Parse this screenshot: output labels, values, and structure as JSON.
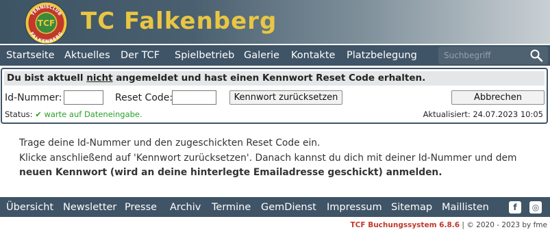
{
  "header": {
    "site_title": "TC Falkenberg",
    "logo_text_top": "TENNISCLUB",
    "logo_text_center": "TCF",
    "logo_text_bottom": "FALKENBERG"
  },
  "topnav": {
    "items": [
      "Startseite",
      "Aktuelles",
      "Der TCF",
      "Spielbetrieb",
      "Galerie",
      "Kontakte",
      "Platzbelegung"
    ]
  },
  "search": {
    "placeholder": "Suchbegriff",
    "value": ""
  },
  "reset_panel": {
    "heading_prefix": "Du bist aktuell ",
    "heading_emph": "nicht",
    "heading_suffix": " angemeldet und hast einen Kennwort Reset Code erhalten.",
    "id_label": "Id-Nummer:",
    "id_value": "",
    "code_label": "Reset Code:",
    "code_value": "",
    "reset_button": "Kennwort zurücksetzen",
    "cancel_button": "Abbrechen",
    "status_label": "Status:",
    "status_check": "✔",
    "status_text": "warte auf Dateneingabe.",
    "updated_text": "Aktualisiert: 24.07.2023 10:05"
  },
  "instructions": {
    "line1": "Trage deine Id-Nummer und den zugeschickten Reset Code ein.",
    "line2": "Klicke anschließend auf 'Kennwort zurücksetzen'. Danach kannst du dich mit deiner Id-Nummer und dem",
    "line3_bold": "neuen Kennwort",
    "line3_rest": " (wird an deine hinterlegte Emailadresse geschickt) anmelden."
  },
  "footnav": {
    "items": [
      "Übersicht",
      "Newsletter",
      "Presse",
      "Archiv",
      "Termine",
      "GemDienst",
      "Impressum",
      "Sitemap",
      "Maillisten"
    ],
    "facebook_glyph": "f",
    "instagram_glyph": "◎"
  },
  "footer": {
    "brand": "TCF Buchungssystem 6.8.6",
    "separator": "|",
    "copyright": "© 2020 - 2023 by fme"
  },
  "colors": {
    "nav_bg": "#3f5466",
    "title_gold": "#e9c642",
    "status_green": "#2aa12a",
    "brand_red": "#c0392b"
  }
}
